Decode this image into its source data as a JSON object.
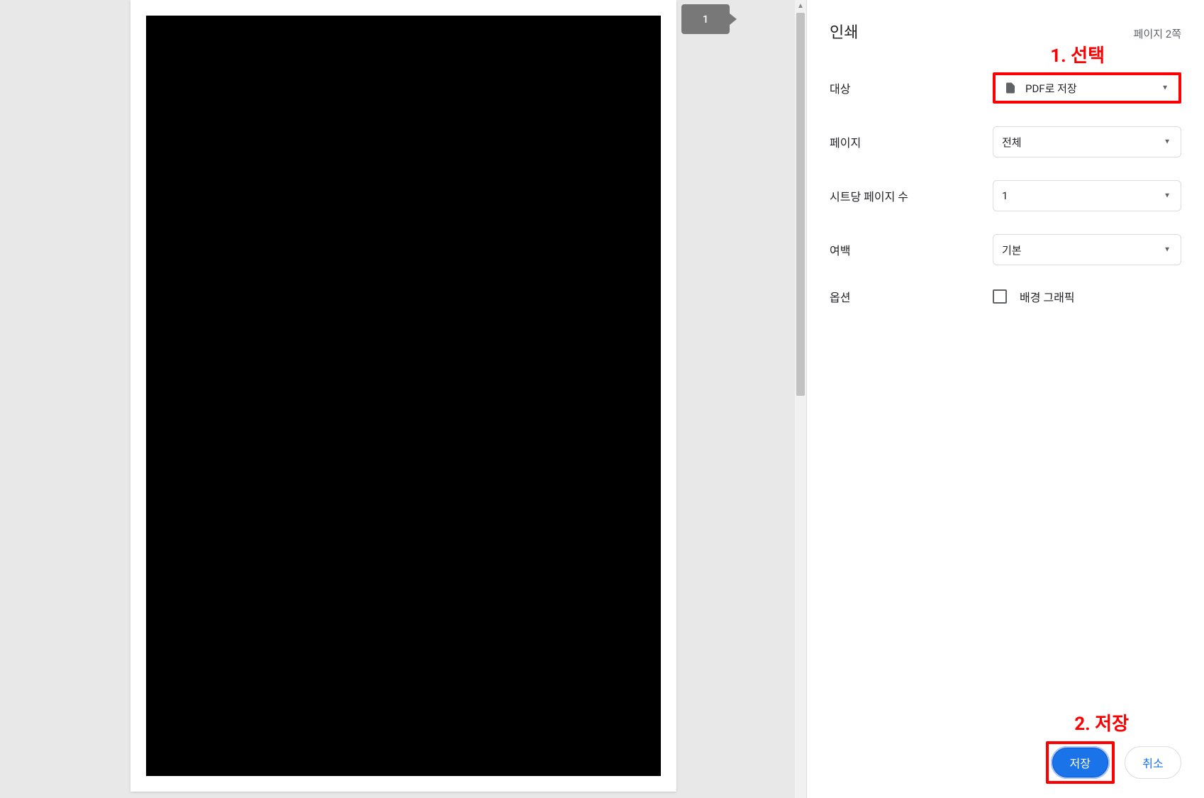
{
  "header": {
    "title": "인쇄",
    "page_count": "페이지 2쪽"
  },
  "preview": {
    "current_page_badge": "1"
  },
  "annotations": {
    "step1": "1. 선택",
    "step2": "2. 저장"
  },
  "settings": {
    "destination": {
      "label": "대상",
      "value": "PDF로 저장"
    },
    "pages": {
      "label": "페이지",
      "value": "전체"
    },
    "pages_per_sheet": {
      "label": "시트당 페이지 수",
      "value": "1"
    },
    "margins": {
      "label": "여백",
      "value": "기본"
    },
    "options": {
      "label": "옵션",
      "checkbox_label": "배경 그래픽"
    }
  },
  "footer": {
    "save": "저장",
    "cancel": "취소"
  }
}
